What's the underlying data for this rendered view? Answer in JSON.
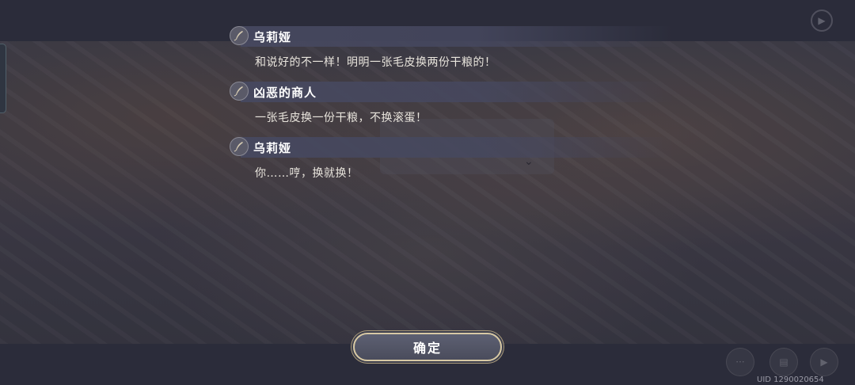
{
  "dialogue_log": [
    {
      "speaker": "乌莉娅",
      "text": "和说好的不一样！明明一张毛皮换两份干粮的！"
    },
    {
      "speaker": "凶恶的商人",
      "text": "一张毛皮换一份干粮，不换滚蛋！"
    },
    {
      "speaker": "乌莉娅",
      "text": "你……哼，换就换！"
    }
  ],
  "confirm_label": "确定",
  "uid_text": "UID 1290020654",
  "icons": {
    "speaker": "quill-icon",
    "skip": "skip-icon",
    "more": "more-icon",
    "chat": "chat-icon",
    "play": "play-icon"
  }
}
